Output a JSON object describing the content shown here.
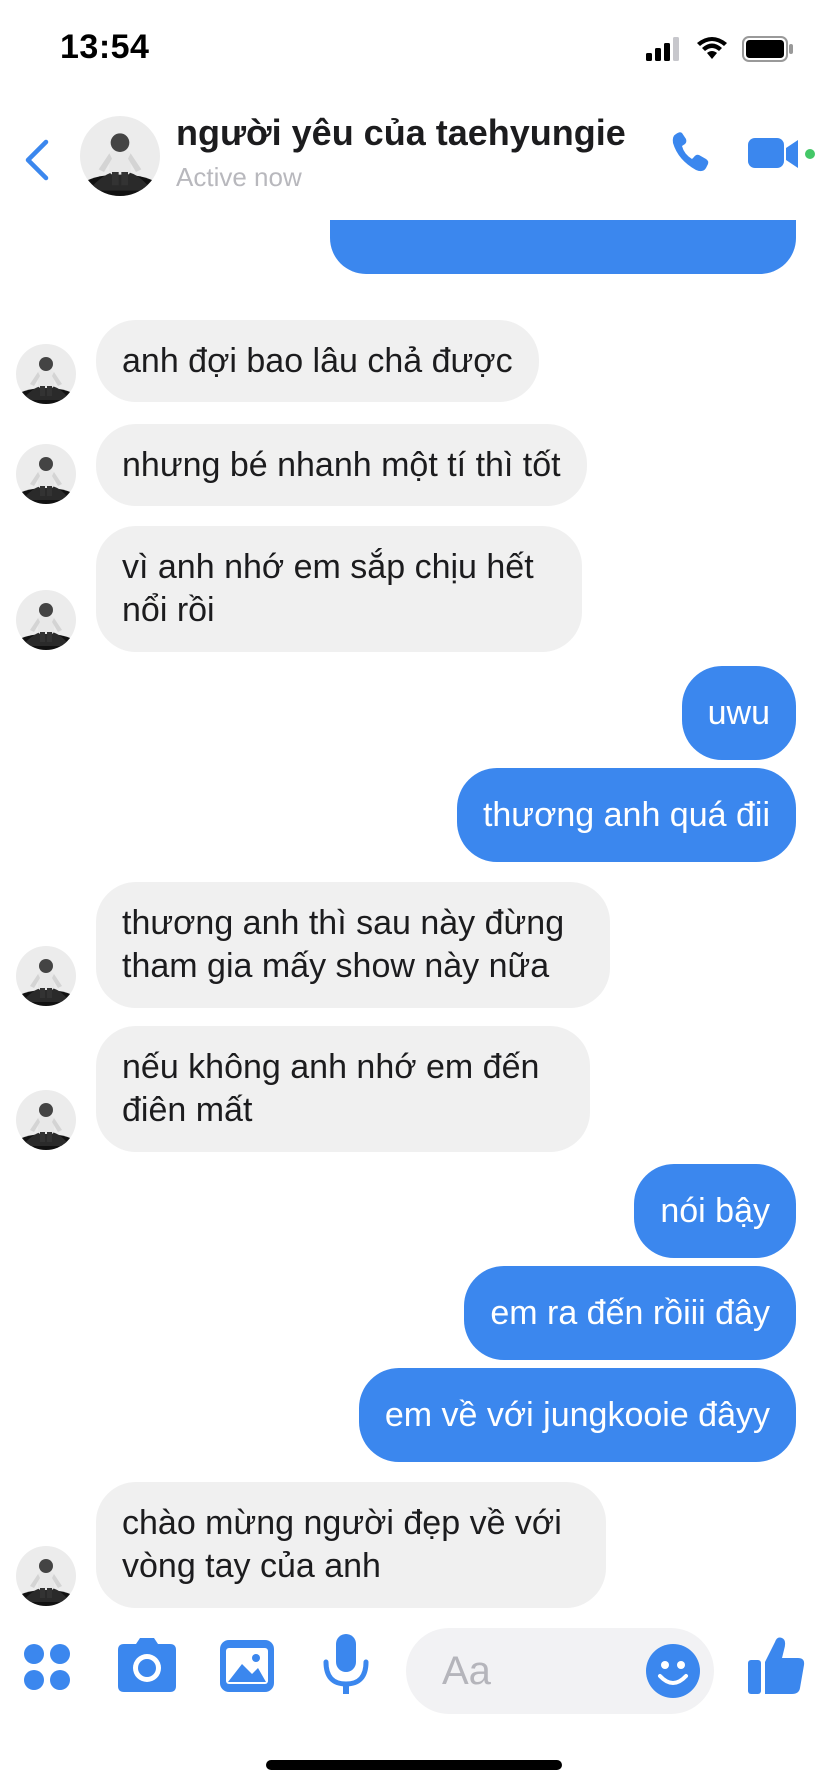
{
  "status_bar": {
    "time": "13:54"
  },
  "header": {
    "contact_name": "người yêu của taehyungie",
    "status": "Active now"
  },
  "messages": [
    {
      "direction": "out",
      "text": ""
    },
    {
      "direction": "in",
      "text": "anh đợi bao lâu chả được"
    },
    {
      "direction": "in",
      "text": "nhưng bé nhanh một tí thì tốt"
    },
    {
      "direction": "in",
      "text": "vì anh nhớ em sắp chịu hết nổi rồi"
    },
    {
      "direction": "out",
      "text": "uwu"
    },
    {
      "direction": "out",
      "text": "thương anh quá đii"
    },
    {
      "direction": "in",
      "text": "thương anh thì sau này đừng tham gia mấy show này nữa"
    },
    {
      "direction": "in",
      "text": "nếu không anh nhớ em đến điên mất"
    },
    {
      "direction": "out",
      "text": "nói bậy"
    },
    {
      "direction": "out",
      "text": "em ra đến rồiii đây"
    },
    {
      "direction": "out",
      "text": "em về với jungkooie đâyy"
    },
    {
      "direction": "in",
      "text": "chào mừng người đẹp về với vòng tay của anh"
    }
  ],
  "composer": {
    "placeholder": "Aa",
    "icons": [
      "apps-icon",
      "camera-icon",
      "photo-icon",
      "microphone-icon",
      "emoji-icon",
      "like-icon"
    ]
  },
  "colors": {
    "accent": "#3b87ee",
    "incoming_bubble": "#f0f0f0",
    "online_dot": "#44c767"
  }
}
